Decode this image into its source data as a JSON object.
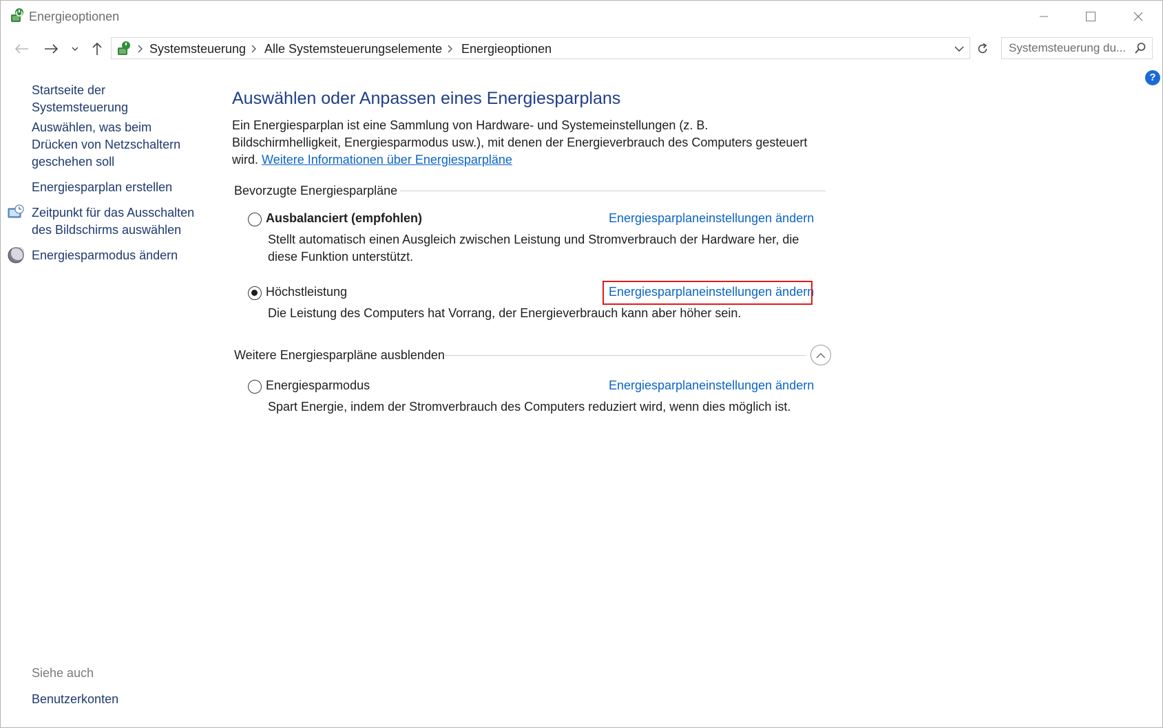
{
  "window": {
    "title": "Energieoptionen",
    "icon": "power-options-icon"
  },
  "nav": {
    "breadcrumbs": [
      "Systemsteuerung",
      "Alle Systemsteuerungselemente",
      "Energieoptionen"
    ],
    "search_placeholder": "Systemsteuerung du..."
  },
  "sidebar": {
    "items": [
      {
        "label": "Startseite der Systemsteuerung",
        "icon": null
      },
      {
        "label": "Auswählen, was beim Drücken von Netzschaltern geschehen soll",
        "icon": null
      },
      {
        "label": "Energiesparplan erstellen",
        "icon": null
      },
      {
        "label": "Zeitpunkt für das Ausschalten des Bildschirms auswählen",
        "icon": "monitor-clock-icon"
      },
      {
        "label": "Energiesparmodus ändern",
        "icon": "moon-icon"
      }
    ],
    "see_also_heading": "Siehe auch",
    "see_also_links": [
      "Benutzerkonten"
    ]
  },
  "main": {
    "title": "Auswählen oder Anpassen eines Energiesparplans",
    "intro_text": "Ein Energiesparplan ist eine Sammlung von Hardware- und Systemeinstellungen (z. B. Bildschirmhelligkeit, Energiesparmodus usw.), mit denen der Energieverbrauch des Computers gesteuert wird.",
    "intro_link": "Weitere Informationen über Energiesparpläne",
    "preferred_heading": "Bevorzugte Energiesparpläne",
    "more_heading": "Weitere Energiesparpläne ausblenden",
    "plans": [
      {
        "name": "Ausbalanciert (empfohlen)",
        "selected": false,
        "link": "Energiesparplaneinstellungen ändern",
        "description": "Stellt automatisch einen Ausgleich zwischen Leistung und Stromverbrauch der Hardware her, die diese Funktion unterstützt."
      },
      {
        "name": "Höchstleistung",
        "selected": true,
        "link": "Energiesparplaneinstellungen ändern",
        "description": "Die Leistung des Computers hat Vorrang, der Energieverbrauch kann aber höher sein."
      },
      {
        "name": "Energiesparmodus",
        "selected": false,
        "link": "Energiesparplaneinstellungen ändern",
        "description": "Spart Energie, indem der Stromverbrauch des Computers reduziert wird, wenn dies möglich ist."
      }
    ]
  },
  "colors": {
    "accent_link": "#0b64c8",
    "title_blue": "#1f3f8a",
    "highlight_red": "#e01b1b",
    "help_blue": "#1a6ad6"
  }
}
